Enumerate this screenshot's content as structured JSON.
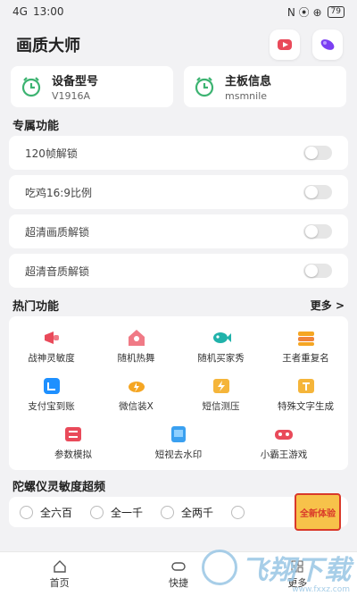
{
  "status": {
    "signal": "4G",
    "time": "13:00",
    "icons": "N ⦿ ⊕",
    "battery": "79"
  },
  "header": {
    "title": "画质大师"
  },
  "info": [
    {
      "title": "设备型号",
      "value": "V1916A"
    },
    {
      "title": "主板信息",
      "value": "msmnile"
    }
  ],
  "exclusive": {
    "title": "专属功能",
    "items": [
      "120帧解锁",
      "吃鸡16:9比例",
      "超清画质解锁",
      "超清音质解锁"
    ]
  },
  "hot": {
    "title": "热门功能",
    "more": "更多 >",
    "row1": [
      "战神灵敏度",
      "随机热舞",
      "随机买家秀",
      "王者重复名"
    ],
    "row2": [
      "支付宝到账",
      "微信装X",
      "短信测压",
      "特殊文字生成"
    ],
    "row3": [
      "参数模拟",
      "短视去水印",
      "小霸王游戏"
    ]
  },
  "gyro": {
    "title": "陀螺仪灵敏度超频",
    "options": [
      "全六百",
      "全一千",
      "全两千"
    ],
    "promo": "全新体验"
  },
  "tabs": [
    "首页",
    "快捷",
    "更多"
  ],
  "watermark": {
    "text": "飞翔下载",
    "url": "www.fxxz.com"
  },
  "colors": {
    "accent_red": "#e94a5a",
    "accent_purple": "#7b3ff2",
    "icon_green": "#3cb371"
  }
}
